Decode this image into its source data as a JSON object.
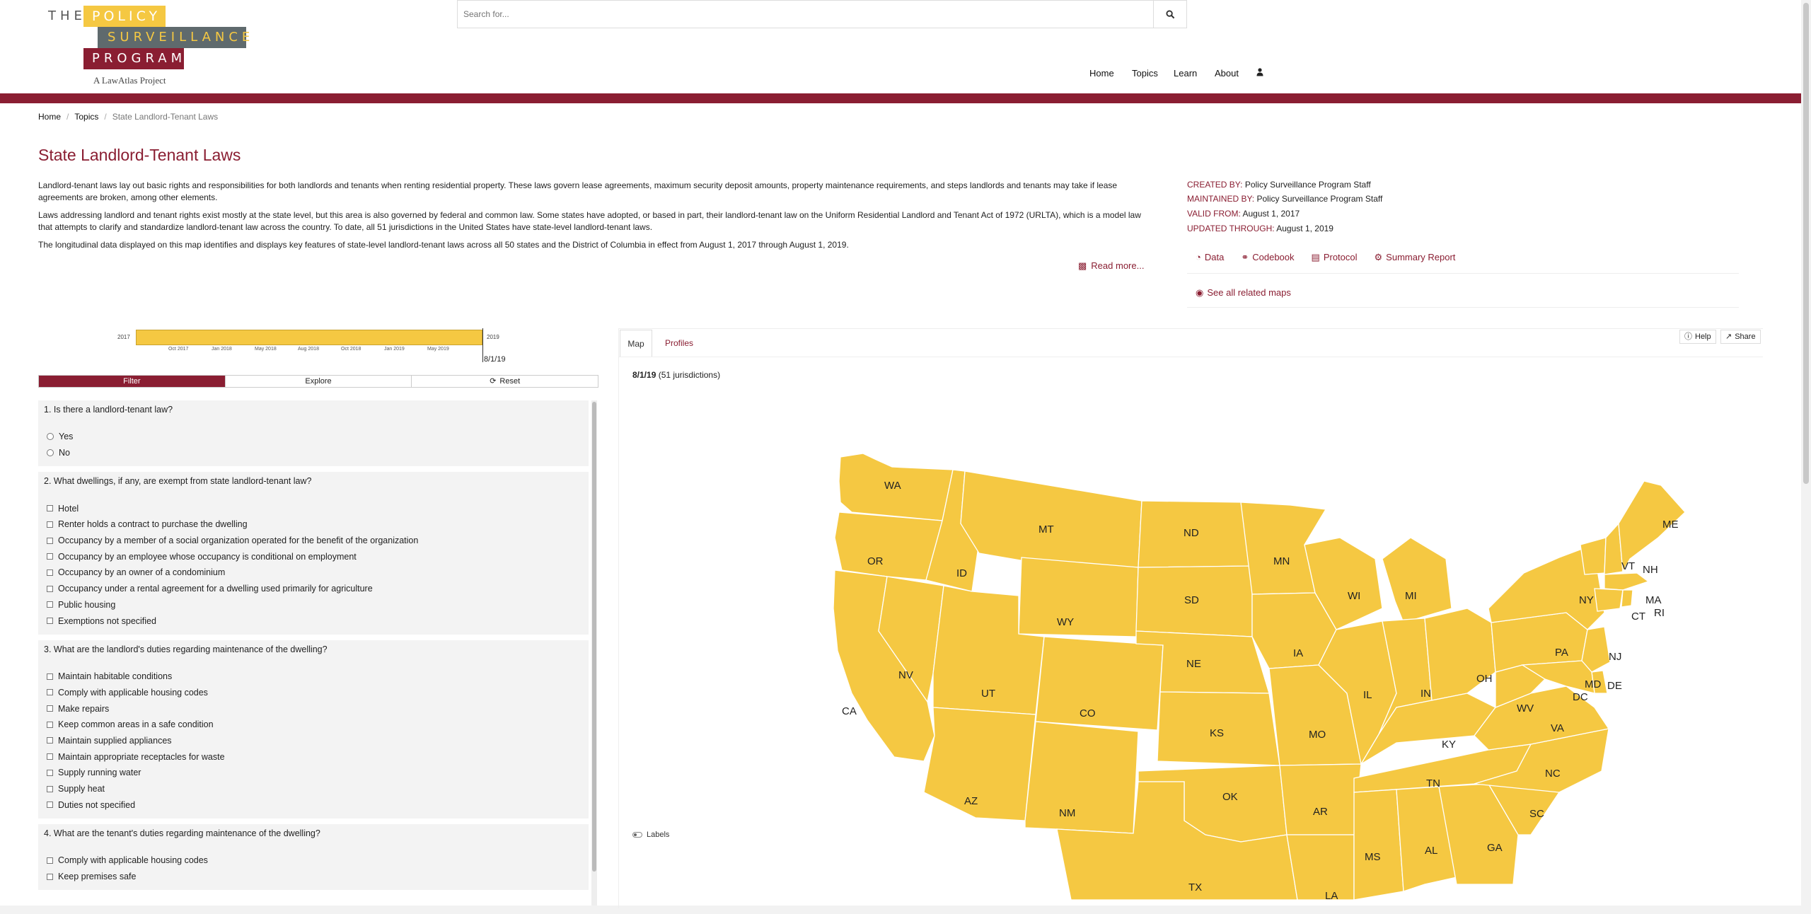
{
  "header": {
    "logo_the": "THE",
    "logo_policy": "POLICY",
    "logo_surveillance": "SURVEILLANCE",
    "logo_program": "PROGRAM",
    "logo_tagline": "A LawAtlas Project",
    "search_placeholder": "Search for...",
    "nav": [
      "Home",
      "Topics",
      "Learn",
      "About"
    ]
  },
  "breadcrumb": [
    "Home",
    "Topics",
    "State Landlord-Tenant Laws"
  ],
  "page_title": "State Landlord-Tenant Laws",
  "description": [
    "Landlord-tenant laws lay out basic rights and responsibilities for both landlords and tenants when renting residential property. These laws govern lease agreements, maximum security deposit amounts, property maintenance requirements, and steps landlords and tenants may take if lease agreements are broken, among other elements.",
    "Laws addressing landlord and tenant rights exist mostly at the state level, but this area is also governed by federal and common law. Some states have adopted, or based in part, their landlord-tenant law on the Uniform Residential Landlord and Tenant Act of 1972 (URLTA), which is a model law that attempts to clarify and standardize landlord-tenant law across the country. To date, all 51 jurisdictions in the United States have state-level landlord-tenant laws.",
    "The longitudinal data displayed on this map identifies and displays key features of state-level landlord-tenant laws across all 50 states and the District of Columbia in effect from August 1, 2017 through August 1, 2019."
  ],
  "read_more": "Read more...",
  "meta": {
    "created_by_label": "CREATED BY:",
    "created_by": "Policy Surveillance Program Staff",
    "maintained_by_label": "MAINTAINED BY:",
    "maintained_by": "Policy Surveillance Program Staff",
    "valid_from_label": "VALID FROM:",
    "valid_from": "August 1, 2017",
    "updated_through_label": "UPDATED THROUGH:",
    "updated_through": "August 1, 2019",
    "links": [
      "Data",
      "Codebook",
      "Protocol",
      "Summary Report"
    ],
    "related": "See all related maps"
  },
  "timeline": {
    "start": "2017",
    "end": "2019",
    "ticks": [
      "Oct 2017",
      "Jan 2018",
      "May 2018",
      "Aug 2018",
      "Oct 2018",
      "Jan 2019",
      "May 2019"
    ],
    "current": "8/1/19"
  },
  "panel_tabs": {
    "filter": "Filter",
    "explore": "Explore",
    "reset": "Reset"
  },
  "questions": [
    {
      "title": "1. Is there a landlord-tenant law?",
      "type": "radio",
      "options": [
        "Yes",
        "No"
      ]
    },
    {
      "title": "2. What dwellings, if any, are exempt from state landlord-tenant law?",
      "type": "checkbox",
      "options": [
        "Hotel",
        "Renter holds a contract to purchase the dwelling",
        "Occupancy by a member of a social organization operated for the benefit of the organization",
        "Occupancy by an employee whose occupancy is conditional on employment",
        "Occupancy by an owner of a condominium",
        "Occupancy under a rental agreement for a dwelling used primarily for agriculture",
        "Public housing",
        "Exemptions not specified"
      ]
    },
    {
      "title": "3. What are the landlord's duties regarding maintenance of the dwelling?",
      "type": "checkbox",
      "options": [
        "Maintain habitable conditions",
        "Comply with applicable housing codes",
        "Make repairs",
        "Keep common areas in a safe condition",
        "Maintain supplied appliances",
        "Maintain appropriate receptacles for waste",
        "Supply running water",
        "Supply heat",
        "Duties not specified"
      ]
    },
    {
      "title": "4. What are the tenant's duties regarding maintenance of the dwelling?",
      "type": "checkbox",
      "options": [
        "Comply with applicable housing codes",
        "Keep premises safe"
      ]
    }
  ],
  "map": {
    "tab_map": "Map",
    "tab_profiles": "Profiles",
    "help": "Help",
    "share": "Share",
    "date": "8/1/19",
    "jurisdictions": "(51 jurisdictions)",
    "labels_toggle": "Labels",
    "fill_color": "#f5c842",
    "states": [
      "WA",
      "OR",
      "CA",
      "ID",
      "NV",
      "MT",
      "WY",
      "UT",
      "AZ",
      "CO",
      "NM",
      "ND",
      "SD",
      "NE",
      "KS",
      "OK",
      "TX",
      "MN",
      "IA",
      "MO",
      "AR",
      "LA",
      "WI",
      "IL",
      "MI",
      "IN",
      "OH",
      "KY",
      "TN",
      "MS",
      "AL",
      "GA",
      "SC",
      "NC",
      "VA",
      "WV",
      "PA",
      "NY",
      "VT",
      "NH",
      "ME",
      "MA",
      "CT",
      "RI",
      "NJ",
      "DE",
      "MD",
      "DC"
    ]
  },
  "colors": {
    "brand": "#8a1e32",
    "accent": "#f5c842",
    "gray": "#5f6a6d"
  }
}
